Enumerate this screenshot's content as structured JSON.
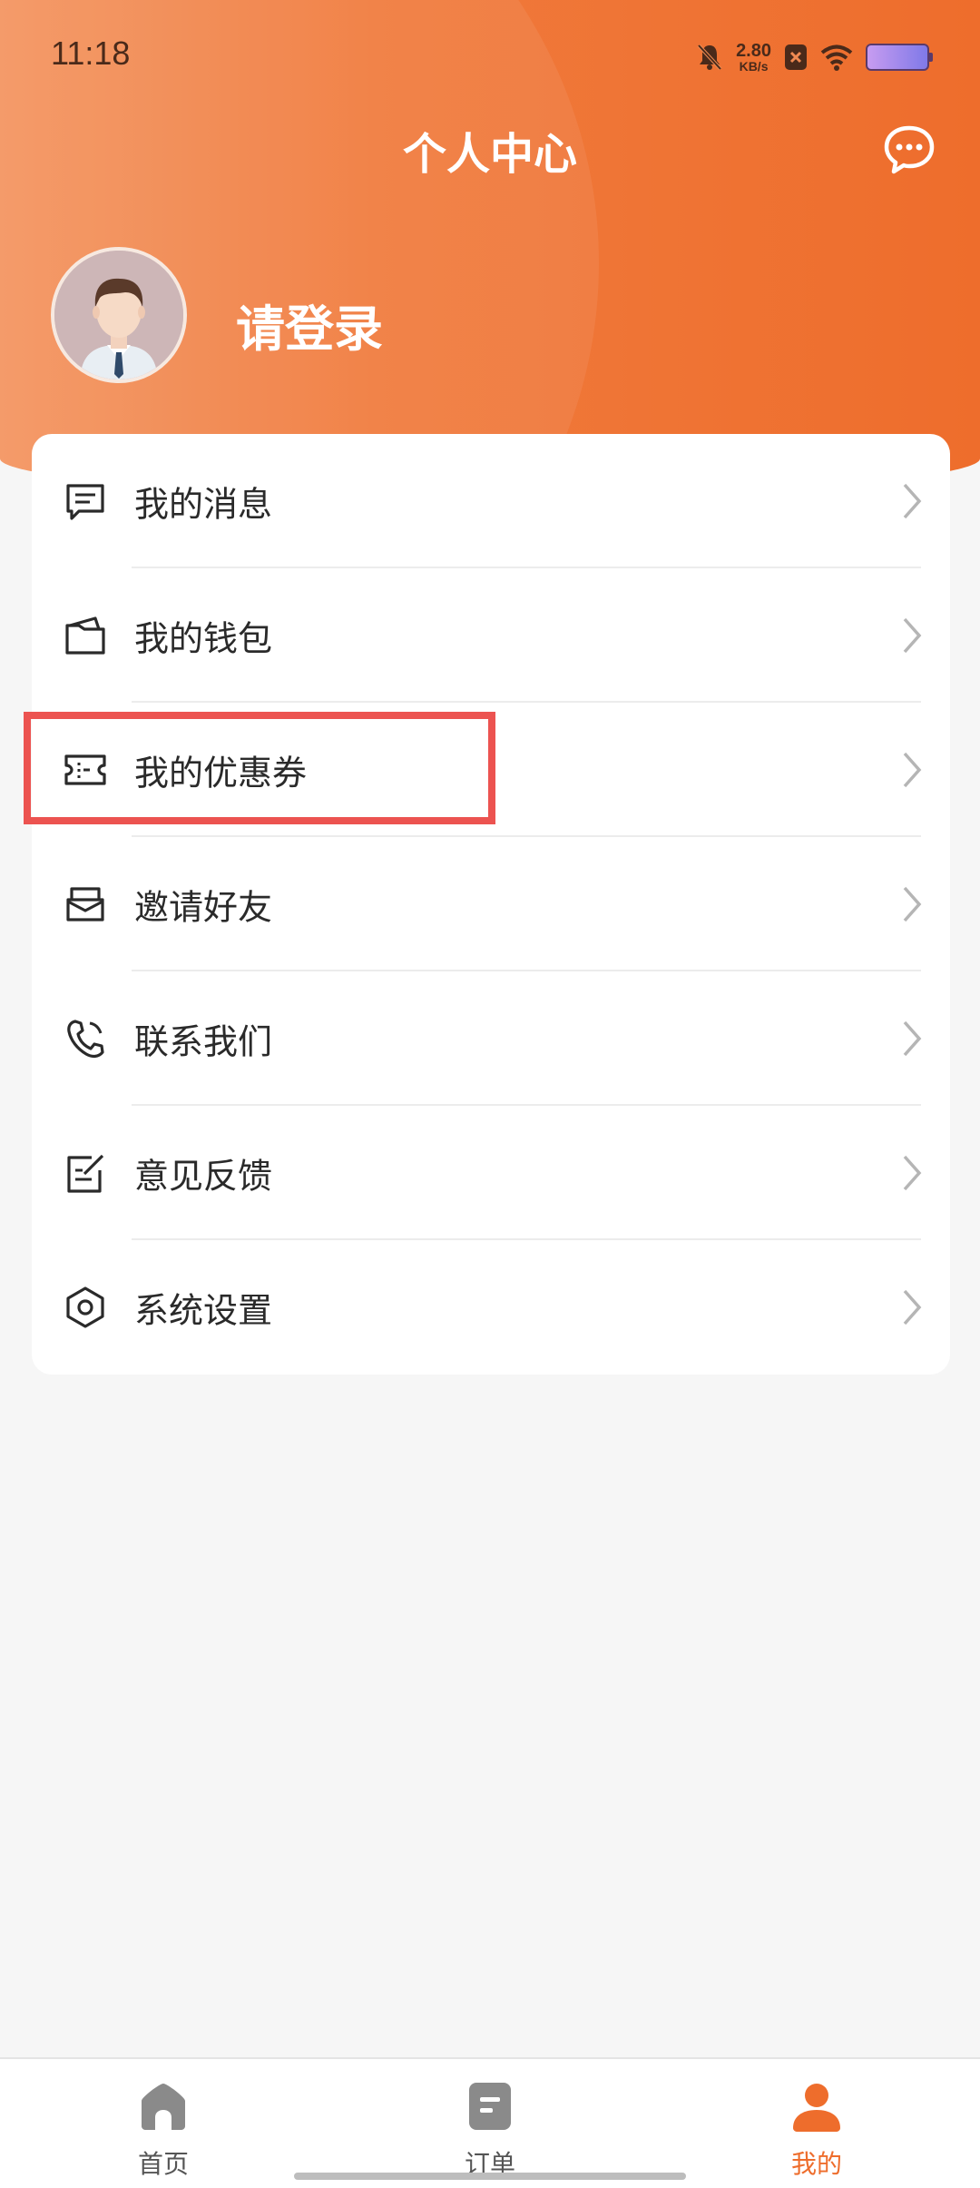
{
  "status_bar": {
    "time": "11:18",
    "net_speed_value": "2.80",
    "net_speed_unit": "KB/s",
    "icons": [
      "bell-muted-icon",
      "sim-x-icon",
      "wifi-icon",
      "battery-icon"
    ]
  },
  "header": {
    "title": "个人中心",
    "message_icon": "chat-bubble-icon"
  },
  "profile": {
    "login_text": "请登录",
    "avatar": "avatar-man"
  },
  "menu": {
    "items": [
      {
        "label": "我的消息",
        "icon": "message-icon"
      },
      {
        "label": "我的钱包",
        "icon": "wallet-icon"
      },
      {
        "label": "我的优惠券",
        "icon": "coupon-icon"
      },
      {
        "label": "邀请好友",
        "icon": "invite-icon"
      },
      {
        "label": "联系我们",
        "icon": "phone-icon"
      },
      {
        "label": "意见反馈",
        "icon": "feedback-icon"
      },
      {
        "label": "系统设置",
        "icon": "settings-icon"
      }
    ],
    "highlighted_index": 2
  },
  "tab_bar": {
    "tabs": [
      {
        "label": "首页",
        "icon": "home-icon",
        "active": false
      },
      {
        "label": "订单",
        "icon": "order-icon",
        "active": false
      },
      {
        "label": "我的",
        "icon": "user-icon",
        "active": true
      }
    ]
  },
  "colors": {
    "accent": "#ee6d2c",
    "highlight_box": "#ec5350",
    "background": "#f6f6f6"
  }
}
